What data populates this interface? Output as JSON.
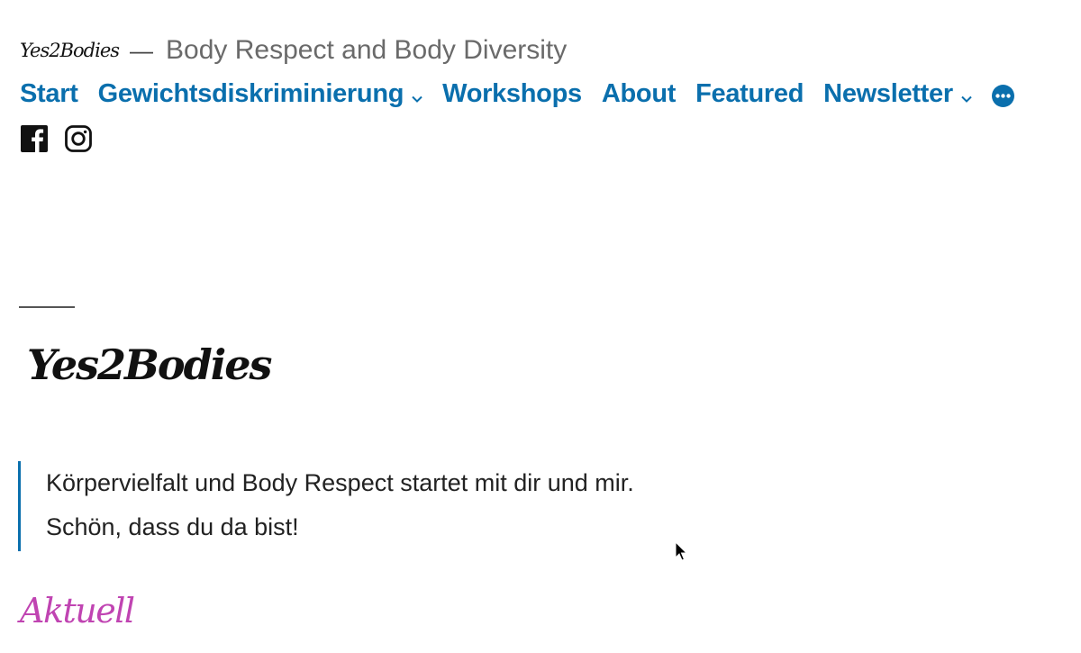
{
  "header": {
    "logo_text": "Yes2Bodies",
    "separator": "—",
    "tagline": "Body Respect and Body Diversity"
  },
  "nav": {
    "items": [
      {
        "label": "Start",
        "has_dropdown": false
      },
      {
        "label": "Gewichtsdiskriminierung",
        "has_dropdown": true
      },
      {
        "label": "Workshops",
        "has_dropdown": false
      },
      {
        "label": "About",
        "has_dropdown": false
      },
      {
        "label": "Featured",
        "has_dropdown": false
      },
      {
        "label": "Newsletter",
        "has_dropdown": true
      }
    ],
    "more_icon": "more-dots-icon"
  },
  "social": {
    "icons": [
      "facebook-icon",
      "instagram-icon"
    ]
  },
  "main": {
    "logo_text": "Yes2Bodies",
    "quote_lines": [
      "Körpervielfalt und Body Respect startet mit dir und mir.",
      "Schön, dass du da bist!"
    ],
    "section_heading": "Aktuell"
  },
  "colors": {
    "link": "#0a6fad",
    "accent_heading": "#c044b2",
    "tagline": "#6a6a6a"
  }
}
